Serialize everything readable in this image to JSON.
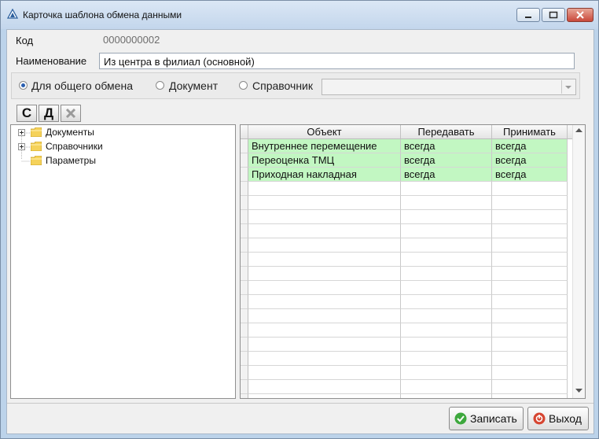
{
  "window": {
    "title": "Карточка шаблона обмена данными",
    "accent_color": "#c3d6ec"
  },
  "form": {
    "kod_label": "Код",
    "kod_value": "0000000002",
    "name_label": "Наименование",
    "name_value": "Из центра в филиал (основной)"
  },
  "exchange_type": {
    "options": [
      {
        "label": "Для общего обмена",
        "checked": true
      },
      {
        "label": "Документ",
        "checked": false
      },
      {
        "label": "Справочник",
        "checked": false
      }
    ],
    "combo_value": ""
  },
  "toolbar": {
    "create_label": "С",
    "delete_label": "Д",
    "clear_icon": "cross-icon"
  },
  "tree": {
    "items": [
      {
        "label": "Документы",
        "expandable": true,
        "icon": "folder-icon"
      },
      {
        "label": "Справочники",
        "expandable": true,
        "icon": "folder-icon"
      },
      {
        "label": "Параметры",
        "expandable": false,
        "icon": "folder-icon"
      }
    ]
  },
  "grid": {
    "columns": [
      "Объект",
      "Передавать",
      "Принимать"
    ],
    "rows": [
      [
        "Внутреннее перемещение",
        "всегда",
        "всегда"
      ],
      [
        "Переоценка ТМЦ",
        "всегда",
        "всегда"
      ],
      [
        "Приходная накладная",
        "всегда",
        "всегда"
      ]
    ],
    "highlight_color": "#c2f7c2"
  },
  "actions": {
    "save_label": "Записать",
    "exit_label": "Выход"
  }
}
